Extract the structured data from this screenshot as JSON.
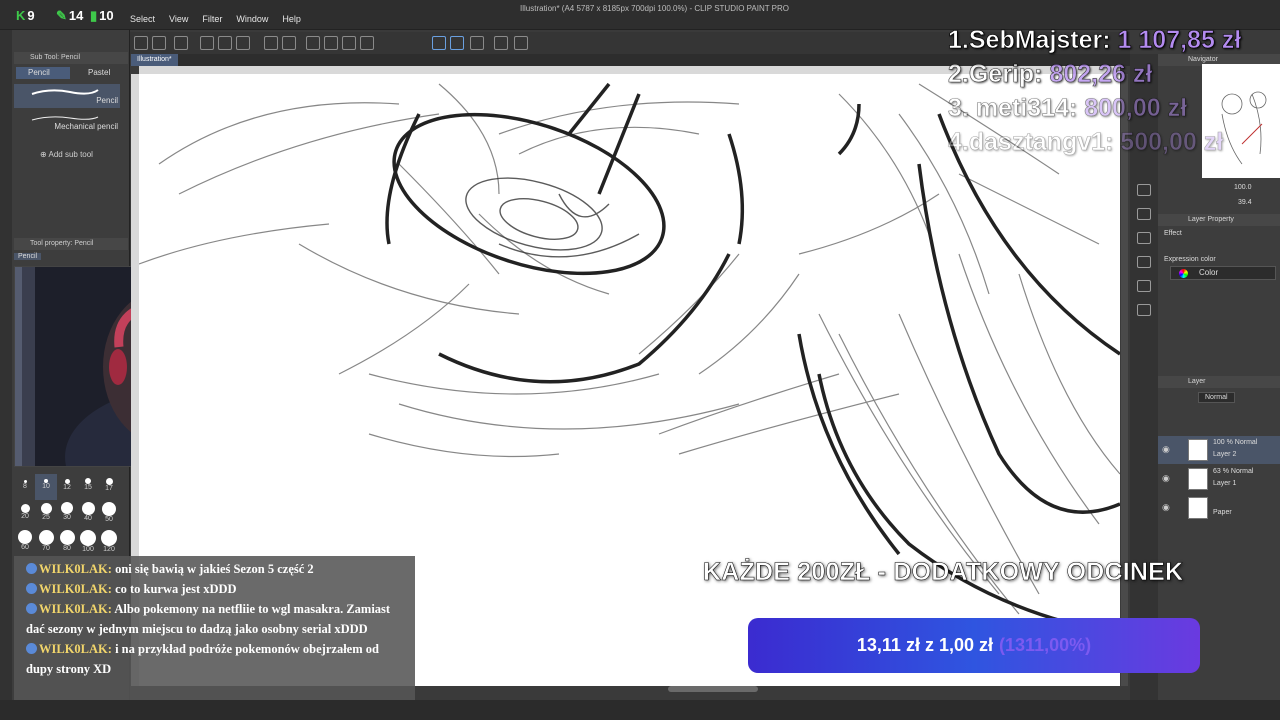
{
  "stats": [
    {
      "glyph": "K",
      "value": "9"
    },
    {
      "glyph": "✎",
      "value": "14"
    },
    {
      "glyph": "▮",
      "value": "10"
    }
  ],
  "menu": [
    "Select",
    "View",
    "Filter",
    "Window",
    "Help"
  ],
  "window_title": "Illustration* (A4 5787 x 8185px 700dpi 100.0%) - CLIP STUDIO PAINT PRO",
  "document_tab": "Illustration*",
  "left_panel": {
    "sub_tool_header": "Sub Tool: Pencil",
    "tabs": [
      "Pencil",
      "Pastel"
    ],
    "brushes": [
      "Pencil",
      "Mechanical pencil"
    ],
    "add_sub_tool": "Add sub tool",
    "tool_property_header": "Tool property: Pencil",
    "tool_property_name": "Pencil"
  },
  "brush_sizes": [
    "8",
    "10",
    "12",
    "15",
    "17",
    "20",
    "25",
    "30",
    "40",
    "50",
    "60",
    "70",
    "80",
    "100",
    "120"
  ],
  "right_panel": {
    "navigator_label": "Navigator",
    "zoom": "100.0",
    "angle": "39.4",
    "layer_property_label": "Layer Property",
    "effect_label": "Effect",
    "expression_color_label": "Expression color",
    "expression_color_value": "Color",
    "layer_label": "Layer",
    "blend_mode": "Normal",
    "layers": [
      {
        "opacity_mode": "100 % Normal",
        "name": "Layer 2",
        "selected": true
      },
      {
        "opacity_mode": "63 % Normal",
        "name": "Layer 1",
        "selected": false
      },
      {
        "opacity_mode": "",
        "name": "Paper",
        "selected": false
      }
    ]
  },
  "donors": [
    {
      "rank": "1.",
      "name": "SebMajster:",
      "amount": "1 107,85 zł"
    },
    {
      "rank": "2.",
      "name": "Gerip:",
      "amount": "802,26 zł"
    },
    {
      "rank": "3.",
      "name": "meti314:",
      "amount": "800,00 zł"
    },
    {
      "rank": "4.",
      "name": "dasztangv1:",
      "amount": "500,00 zł"
    }
  ],
  "chat": [
    {
      "user": "WILK0LAK:",
      "text": "oni się bawią w jakieś Sezon 5 część 2"
    },
    {
      "user": "WILK0LAK:",
      "text": "co to kurwa jest xDDD"
    },
    {
      "user": "WILK0LAK:",
      "text": "Albo pokemony na netfliie to wgl masakra. Zamiast dać sezony w jednym miejscu to dadzą jako osobny serial xDDD"
    },
    {
      "user": "WILK0LAK:",
      "text": "i na przykład podróże pokemonów obejrzałem od dupy strony XD"
    }
  ],
  "banner": "KAŻDE 200ZŁ - DODATKOWY ODCINEK",
  "goal": {
    "current": "13,11 zł",
    "joiner": "z",
    "target": "1,00 zł",
    "percent": "(1311,00%)"
  },
  "colors": {
    "donor_amount": "#b48cf0",
    "goal_bar": "#2f55e0",
    "chat_user": "#f1d56b",
    "stat_green": "#3ec94a"
  }
}
